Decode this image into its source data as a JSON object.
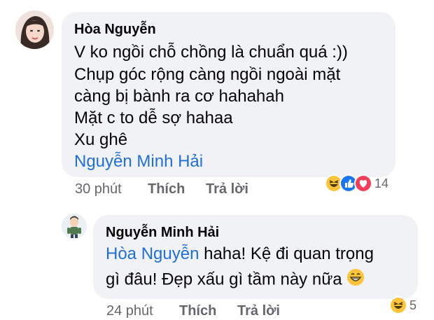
{
  "comment": {
    "author": "Hòa Nguyễn",
    "lines": [
      "V ko ngồi chỗ chồng là chuẩn quá :))",
      "Chụp góc rộng càng ngồi ngoài mặt",
      "càng bị bành ra cơ hahahah",
      "Mặt c to dễ sợ hahaa",
      "Xu ghê"
    ],
    "mention": "Nguyễn Minh Hải",
    "time": "30 phút",
    "like_label": "Thích",
    "reply_label": "Trả lời",
    "reaction_icons": [
      "haha-icon",
      "like-icon",
      "love-icon"
    ],
    "reaction_count": "14"
  },
  "reply": {
    "author": "Nguyễn Minh Hải",
    "mention": "Hòa Nguyễn",
    "line1_rest": " haha! Kệ đi quan trọng",
    "line2": "gì đâu! Đẹp xấu gì tầm này nữa",
    "emoji": "😁",
    "time": "24 phút",
    "like_label": "Thích",
    "reply_label": "Trả lời",
    "reaction_icons": [
      "haha-icon"
    ],
    "reaction_count": "5"
  }
}
